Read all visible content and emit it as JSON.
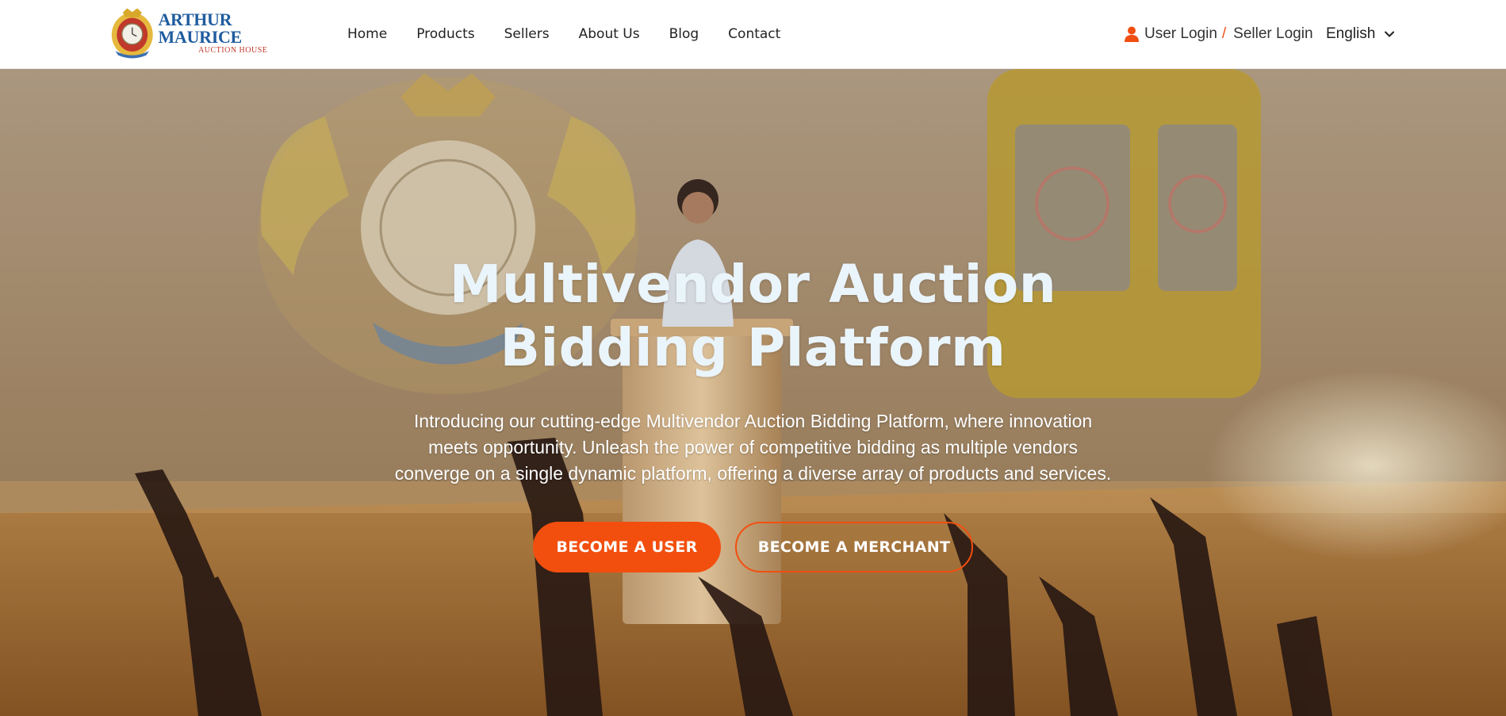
{
  "brand": {
    "name": "ARTHUR MAURICE",
    "subtitle": "AUCTION HOUSE"
  },
  "nav": {
    "items": [
      {
        "label": "Home"
      },
      {
        "label": "Products"
      },
      {
        "label": "Sellers"
      },
      {
        "label": "About Us"
      },
      {
        "label": "Blog"
      },
      {
        "label": "Contact"
      }
    ]
  },
  "account": {
    "user_icon": "user-icon",
    "user_login": "User Login",
    "separator": "/",
    "seller_login": "Seller Login"
  },
  "language": {
    "selected": "English",
    "icon": "chevron-down-icon"
  },
  "hero": {
    "title": "Multivendor Auction Bidding Platform",
    "description": "Introducing our cutting-edge Multivendor Auction Bidding Platform, where innovation meets opportunity. Unleash the power of competitive bidding as multiple vendors converge on a single dynamic platform, offering a diverse array of products and services.",
    "primary_button": "BECOME A USER",
    "secondary_button": "BECOME A MERCHANT"
  },
  "colors": {
    "accent": "#f24f0f",
    "brand_blue": "#1f5c9e",
    "title_text": "#eaf4fb"
  }
}
